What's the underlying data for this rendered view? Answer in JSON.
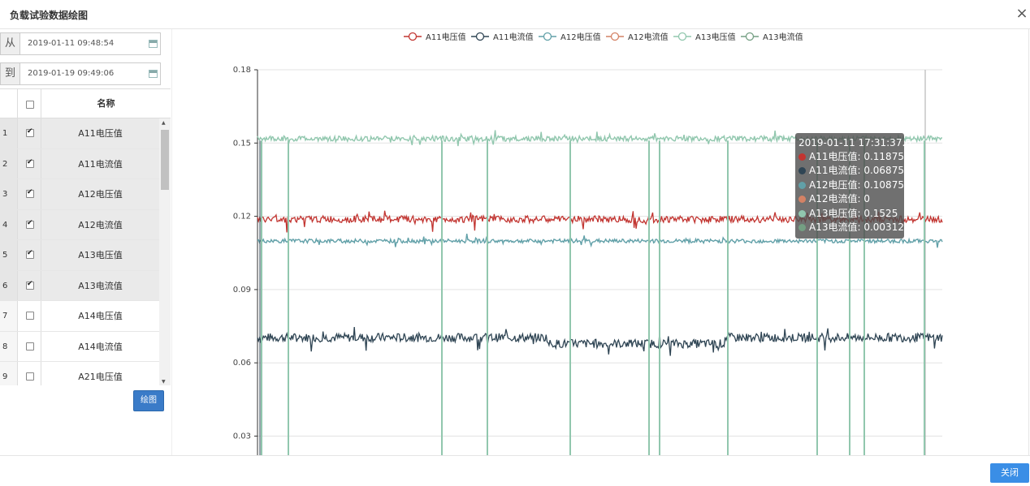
{
  "dialog": {
    "title": "负载试验数据绘图",
    "close_icon": "close-icon"
  },
  "filter": {
    "from_label": "从",
    "from_value": "2019-01-11 09:48:54",
    "to_label": "到",
    "to_value": "2019-01-19 09:49:06"
  },
  "table": {
    "header_name": "名称",
    "rows": [
      {
        "num": "1",
        "name": "A11电压值",
        "checked": true
      },
      {
        "num": "2",
        "name": "A11电流值",
        "checked": true
      },
      {
        "num": "3",
        "name": "A12电压值",
        "checked": true
      },
      {
        "num": "4",
        "name": "A12电流值",
        "checked": true
      },
      {
        "num": "5",
        "name": "A13电压值",
        "checked": true
      },
      {
        "num": "6",
        "name": "A13电流值",
        "checked": true
      },
      {
        "num": "7",
        "name": "A14电压值",
        "checked": false
      },
      {
        "num": "8",
        "name": "A14电流值",
        "checked": false
      },
      {
        "num": "9",
        "name": "A21电压值",
        "checked": false
      }
    ]
  },
  "plot_button": "绘图",
  "footer": {
    "close_button": "关闭"
  },
  "chart_data": {
    "type": "line",
    "y_ticks": [
      "0.18",
      "0.15",
      "0.12",
      "0.09",
      "0.06",
      "0.03"
    ],
    "ylim": [
      0.03,
      0.18
    ],
    "grid": true,
    "legend_position": "top",
    "series": [
      {
        "name": "A11电压值",
        "color": "#c23531",
        "approx_value": 0.11875
      },
      {
        "name": "A11电流值",
        "color": "#2f4554",
        "approx_value": 0.06875
      },
      {
        "name": "A12电压值",
        "color": "#61a0a8",
        "approx_value": 0.10875
      },
      {
        "name": "A12电流值",
        "color": "#d48265",
        "approx_value": 0
      },
      {
        "name": "A13电压值",
        "color": "#91c7ae",
        "approx_value": 0.1525
      },
      {
        "name": "A13电流值",
        "color": "#749f83",
        "approx_value": 0.003125
      }
    ],
    "tooltip": {
      "time": "2019-01-11 17:31:37.0",
      "rows": [
        {
          "label": "A11电压值: 0.11875",
          "color": "#c23531"
        },
        {
          "label": "A11电流值: 0.06875",
          "color": "#2f4554"
        },
        {
          "label": "A12电压值: 0.10875",
          "color": "#61a0a8"
        },
        {
          "label": "A12电流值: 0",
          "color": "#d48265"
        },
        {
          "label": "A13电压值: 0.1525",
          "color": "#91c7ae"
        },
        {
          "label": "A13电流值: 0.003125",
          "color": "#749f83"
        }
      ]
    }
  }
}
